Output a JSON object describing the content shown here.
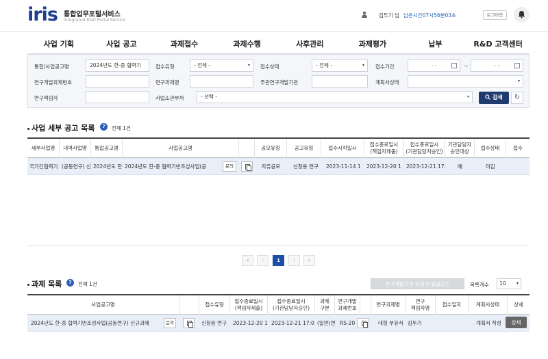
{
  "header": {
    "logo": "iris",
    "brand_title": "통합업무포털서비스",
    "brand_subtitle": "Integrated R&D Portal Service",
    "user_name": "김두기 님",
    "session_time": "남은시간07시56분03초",
    "logout_label": "로그아웃"
  },
  "nav": {
    "items": [
      "사업 기획",
      "사업 공고",
      "과제접수",
      "과제수행",
      "사후관리",
      "과제평가",
      "납부",
      "R&D 고객센터"
    ]
  },
  "search": {
    "labels": {
      "notice_name": "통합/사업공고명",
      "receipt_type": "접수유형",
      "receipt_status": "접수상태",
      "receipt_period": "접수기간",
      "rnd_task_no": "연구개발과제번호",
      "task_name": "연구과제명",
      "lead_org": "주관연구개발기관",
      "plan_status": "계획서상태",
      "researcher": "연구책임자",
      "ministry": "사업소관부처"
    },
    "values": {
      "notice_name": "2024년도 한-중 협력기",
      "receipt_type": "- 전체 -",
      "receipt_status": "- 전체 -",
      "date_from": "- -",
      "date_to": "- -",
      "rnd_task_no": "",
      "task_name": "",
      "lead_org": "",
      "plan_status": "",
      "researcher": "",
      "ministry": "- 선택 -"
    },
    "tilde": "~",
    "search_button": "검색",
    "reset_icon": "refresh-icon"
  },
  "notices": {
    "title": "사업 세부 공고 목록",
    "count": "전체 1건",
    "columns": [
      "세부사업명",
      "내역사업명",
      "통합공고명",
      "사업공고명",
      "",
      "공모유형",
      "공고유형",
      "접수시작일시",
      "접수종료일시\n(책임자제출)",
      "접수종료일시\n(기관담당자승인)",
      "기관담당자\n승인대상",
      "접수상태",
      "접수"
    ],
    "row": {
      "detail_program": "국가간협력기",
      "sub_program": "(공동연구) 신",
      "integrated_notice": "2024년도 한-중",
      "notice_name": "2024년도 한-중 협력기반조성사업(공",
      "inquiry": "문의",
      "contest_type": "자유공모",
      "notice_type": "신청용 연구",
      "start": "2023-11-14 1",
      "end_submit": "2023-12-20 1",
      "end_approve": "2023-12-21 17:",
      "approve_target": "예",
      "status": "마감",
      "receipt": ""
    }
  },
  "pagination": {
    "first": "«",
    "prev": "‹",
    "current": "1",
    "next": "›",
    "last": "»"
  },
  "tasks": {
    "title": "과제 목록",
    "count": "전체 1건",
    "approve_button": "연구개발기관 담당자 일괄승인",
    "rows_label": "목록개수",
    "rows_value": "10",
    "columns": [
      "사업공고명",
      "",
      "접수유형",
      "접수종료일시\n(책임자제출)",
      "접수종료일시\n(기관담당자승인)",
      "과제\n구분",
      "연구개발\n과제번호",
      "",
      "연구과제명",
      "연구\n책임자명",
      "접수일자",
      "계획서상태",
      "상세"
    ],
    "row": {
      "notice_name": "2024년도 한-중 협력기반조성사업(공동연구) 신규과제",
      "inquiry": "문의",
      "receipt_type": "신청용 연구",
      "end_submit": "2023-12-20 1",
      "end_approve": "2023-12-21 17:0",
      "task_kind": "(일반)연",
      "task_no": "RS-20",
      "task_name": "대형 부유식",
      "researcher": "김두기",
      "receipt_date": "",
      "plan_status": "계획서 작성",
      "detail": "상세"
    }
  },
  "colors": {
    "brand": "#1d3f8e",
    "accent": "#e8382f",
    "search_button": "#1e3a6e",
    "active_page": "#1e4fa8",
    "row_highlight": "#e9eff8"
  }
}
